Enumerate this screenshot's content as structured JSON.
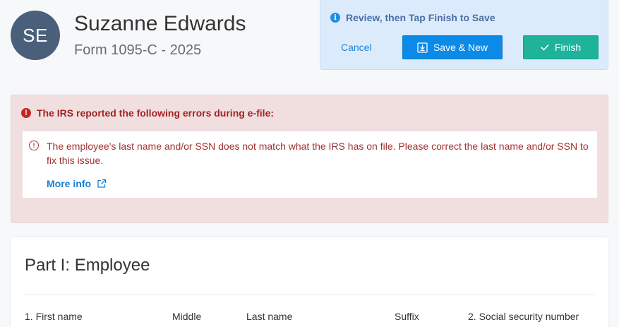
{
  "header": {
    "avatar_initials": "SE",
    "person_name": "Suzanne Edwards",
    "form_subtitle": "Form 1095-C - 2025"
  },
  "save_panel": {
    "hint_icon": "info-icon",
    "hint": "Review, then Tap Finish to Save",
    "cancel_label": "Cancel",
    "save_new_icon": "download-icon",
    "save_new_label": "Save & New",
    "finish_icon": "check-icon",
    "finish_label": "Finish"
  },
  "error_panel": {
    "heading_icon": "error-icon",
    "heading": "The IRS reported the following errors during e-file:",
    "errors": [
      {
        "icon": "error-outline-icon",
        "message": "The employee's last name and/or SSN does not match what the IRS has on file. Please correct the last name and/or SSN to fix this issue.",
        "link_label": "More info",
        "link_icon": "external-link-icon"
      }
    ]
  },
  "part1": {
    "title": "Part I: Employee",
    "fields": [
      {
        "label": "1. First name"
      },
      {
        "label": "Middle"
      },
      {
        "label": "Last name"
      },
      {
        "label": "Suffix"
      },
      {
        "label": "2. Social security number"
      }
    ]
  },
  "colors": {
    "avatar_bg": "#4a5f7a",
    "save_panel_bg": "#dcebfb",
    "save_new_button": "#0b8ae8",
    "finish_button": "#1eb39a",
    "error_bg": "#f1dfe0",
    "error_text": "#a32222",
    "link": "#1b7fd0"
  }
}
